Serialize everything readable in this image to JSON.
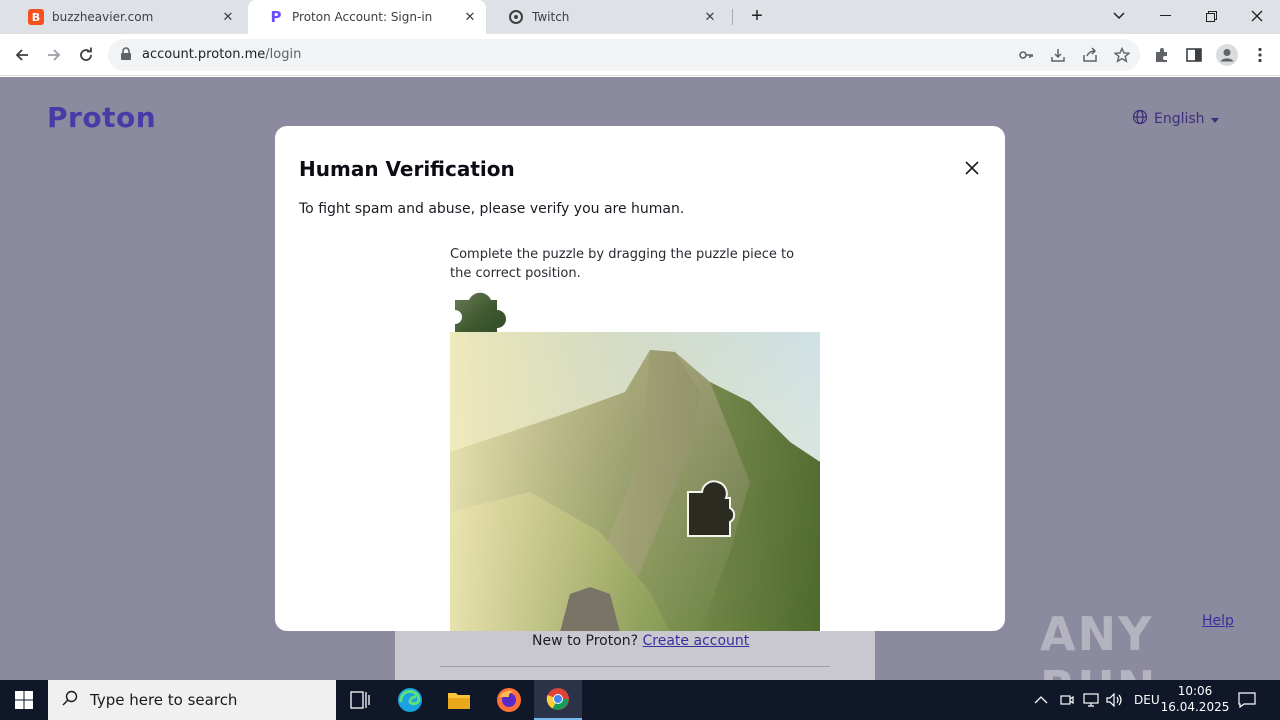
{
  "browser": {
    "tabs": [
      {
        "title": "buzzheavier.com",
        "favicon": "buzzheavier-favicon",
        "favicon_letter": "B",
        "favicon_color": "#f4511e"
      },
      {
        "title": "Proton Account: Sign-in",
        "favicon": "proton-favicon",
        "favicon_letter": "P",
        "favicon_color": "#6d4aff"
      },
      {
        "title": "Twitch",
        "favicon": "twitch-favicon",
        "favicon_letter": "",
        "favicon_color": "#3c4043"
      }
    ],
    "active_tab": 1,
    "url_host": "account.proton.me",
    "url_path": "/login"
  },
  "page": {
    "brand": "Proton",
    "language": "English",
    "new_to_proton": "New to Proton?",
    "create_account": "Create account",
    "help": "Help",
    "watermark": "ANY RUN"
  },
  "modal": {
    "title": "Human Verification",
    "description": "To fight spam and abuse, please verify you are human.",
    "instruction": "Complete the puzzle by dragging the puzzle piece to the correct position."
  },
  "taskbar": {
    "search_placeholder": "Type here to search",
    "language": "DEU",
    "time": "10:06",
    "date": "16.04.2025"
  },
  "colors": {
    "accent": "#6d4aff",
    "overlay": "#8c8a9e",
    "taskbar": "#0f1729"
  }
}
